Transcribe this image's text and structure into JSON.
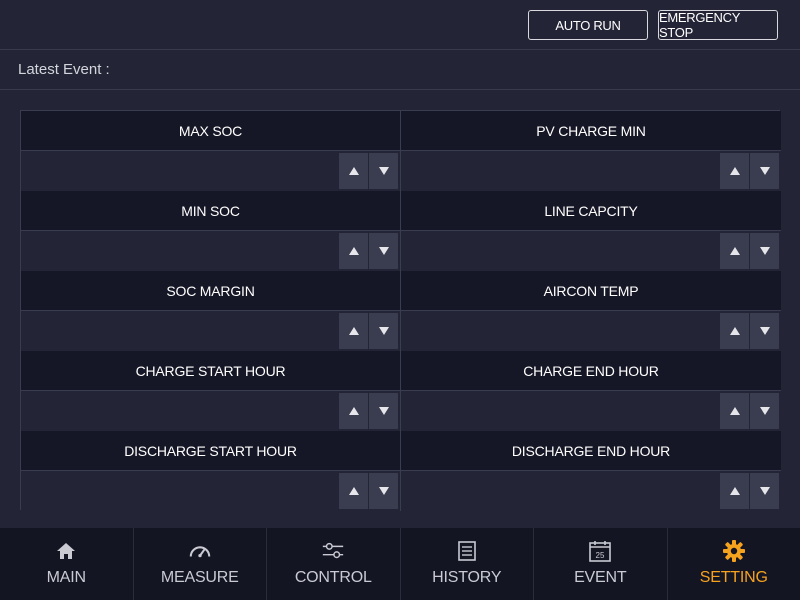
{
  "header": {
    "auto_run_label": "AUTO RUN",
    "emergency_stop_label": "EMERGENCY STOP"
  },
  "event": {
    "label": "Latest Event :",
    "value": ""
  },
  "settings": [
    {
      "label": "MAX SOC",
      "value": ""
    },
    {
      "label": "PV CHARGE MIN",
      "value": ""
    },
    {
      "label": "MIN SOC",
      "value": ""
    },
    {
      "label": "LINE CAPCITY",
      "value": ""
    },
    {
      "label": "SOC MARGIN",
      "value": ""
    },
    {
      "label": "AIRCON TEMP",
      "value": ""
    },
    {
      "label": "CHARGE START HOUR",
      "value": ""
    },
    {
      "label": "CHARGE END HOUR",
      "value": ""
    },
    {
      "label": "DISCHARGE START HOUR",
      "value": ""
    },
    {
      "label": "DISCHARGE END HOUR",
      "value": ""
    }
  ],
  "nav": [
    {
      "label": "MAIN",
      "icon": "home-icon"
    },
    {
      "label": "MEASURE",
      "icon": "gauge-icon"
    },
    {
      "label": "CONTROL",
      "icon": "sliders-icon"
    },
    {
      "label": "HISTORY",
      "icon": "list-icon"
    },
    {
      "label": "EVENT",
      "icon": "calendar-icon",
      "icon_text": "25"
    },
    {
      "label": "SETTING",
      "icon": "gear-icon",
      "active": true
    }
  ],
  "colors": {
    "background": "#232536",
    "header_cell": "#161726",
    "active_nav": "#f5a21f"
  }
}
